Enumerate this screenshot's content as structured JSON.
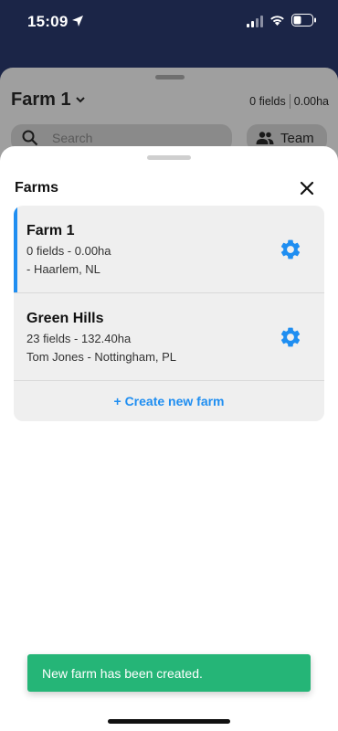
{
  "status_bar": {
    "time": "15:09",
    "icons": [
      "location-icon",
      "signal-icon",
      "wifi-icon",
      "battery-icon"
    ]
  },
  "background_screen": {
    "farm_title": "Farm 1",
    "fields_count": "0 fields",
    "area": "0.00ha",
    "search_placeholder": "Search",
    "team_label": "Team"
  },
  "modal": {
    "title": "Farms",
    "farms": [
      {
        "name": "Farm 1",
        "meta": "0 fields - 0.00ha",
        "location": "- Haarlem, NL",
        "selected": true
      },
      {
        "name": "Green Hills",
        "meta": "23 fields - 132.40ha",
        "location": "Tom Jones - Nottingham, PL",
        "selected": false
      }
    ],
    "create_label": "+ Create new farm"
  },
  "toast": {
    "message": "New farm has been created."
  },
  "colors": {
    "accent": "#1f8ef1",
    "toast": "#25b577",
    "top_bar": "#1b2547"
  }
}
